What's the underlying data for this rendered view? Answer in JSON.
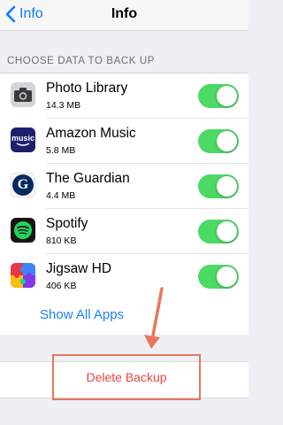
{
  "nav": {
    "back_label": "Info",
    "title": "Info"
  },
  "section_header": "CHOOSE DATA TO BACK UP",
  "apps": [
    {
      "name": "Photo Library",
      "size": "14.3 MB",
      "icon": "camera-icon",
      "enabled": true
    },
    {
      "name": "Amazon Music",
      "size": "5.8 MB",
      "icon": "amazon-music-icon",
      "enabled": true
    },
    {
      "name": "The Guardian",
      "size": "4.4 MB",
      "icon": "guardian-icon",
      "enabled": true
    },
    {
      "name": "Spotify",
      "size": "810 KB",
      "icon": "spotify-icon",
      "enabled": true
    },
    {
      "name": "Jigsaw HD",
      "size": "406 KB",
      "icon": "jigsaw-icon",
      "enabled": true
    }
  ],
  "show_all_label": "Show All Apps",
  "amazon_icon_text": "music",
  "guardian_icon_text": "G",
  "delete_label": "Delete Backup",
  "colors": {
    "accent": "#0a7aff",
    "toggle_on": "#4cd964",
    "destructive": "#e8453c",
    "annotation": "#e8765b"
  }
}
